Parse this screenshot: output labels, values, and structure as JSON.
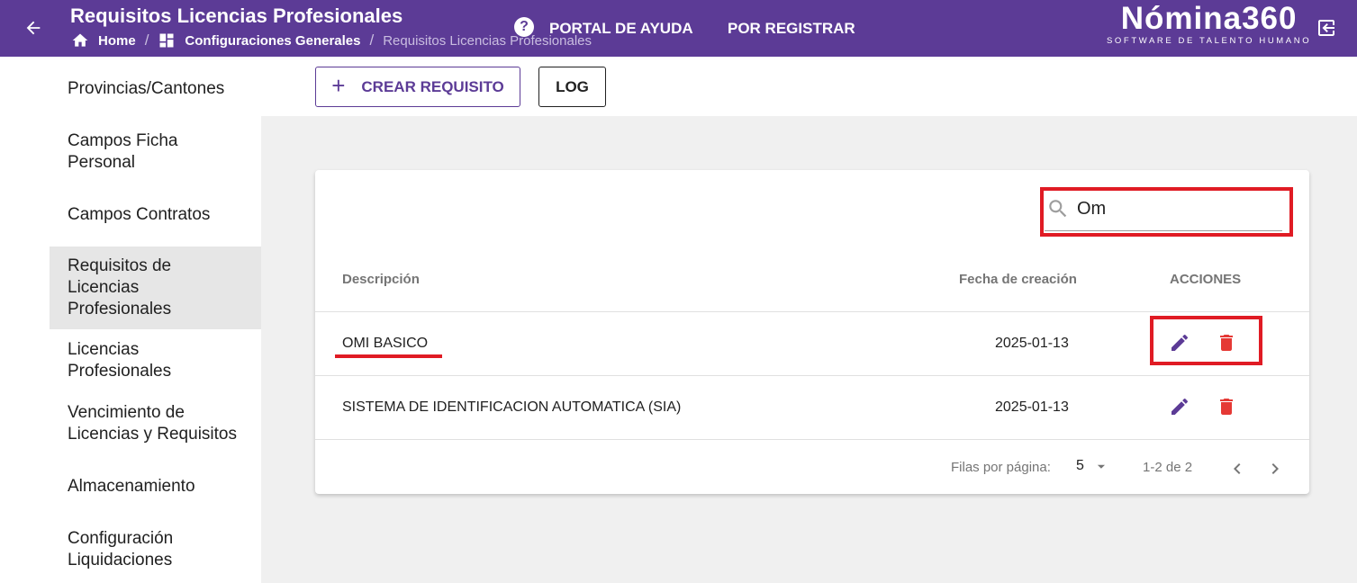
{
  "header": {
    "title": "Requisitos Licencias Profesionales",
    "breadcrumb": {
      "home": "Home",
      "config": "Configuraciones Generales",
      "current": "Requisitos Licencias Profesionales"
    },
    "help_label": "PORTAL DE AYUDA",
    "register_label": "POR REGISTRAR",
    "logo_main": "Nómina360",
    "logo_sub": "SOFTWARE DE TALENTO HUMANO",
    "background_color": "#5c3b96"
  },
  "sidebar": {
    "items": [
      {
        "label": "Provincias/Cantones",
        "active": false
      },
      {
        "label": "Campos Ficha Personal",
        "active": false
      },
      {
        "label": "Campos Contratos",
        "active": false
      },
      {
        "label": "Requisitos de Licencias Profesionales",
        "active": true
      },
      {
        "label": "Licencias Profesionales",
        "active": false
      },
      {
        "label": "Vencimiento de Licencias y Requisitos",
        "active": false
      },
      {
        "label": "Almacenamiento",
        "active": false
      },
      {
        "label": "Configuración Liquidaciones",
        "active": false
      }
    ]
  },
  "toolbar": {
    "create_label": "CREAR REQUISITO",
    "log_label": "LOG"
  },
  "search": {
    "value": "Om",
    "icon": "search-icon"
  },
  "table": {
    "headers": {
      "description": "Descripción",
      "date": "Fecha de creación",
      "actions": "ACCIONES"
    },
    "rows": [
      {
        "description": "OMI BASICO",
        "date": "2025-01-13"
      },
      {
        "description": "SISTEMA DE IDENTIFICACION AUTOMATICA (SIA)",
        "date": "2025-01-13"
      }
    ],
    "edit_color": "#5c3b96",
    "delete_color": "#e53935"
  },
  "pagination": {
    "rows_label": "Filas por página:",
    "rows_value": "5",
    "range": "1-2 de 2"
  },
  "annotations": {
    "highlight_color": "#e01b24"
  }
}
